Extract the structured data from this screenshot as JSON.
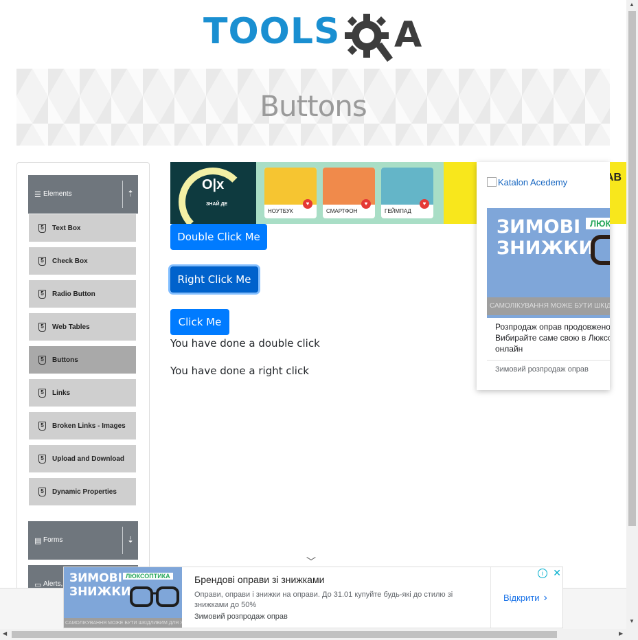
{
  "header": {
    "logo_text_tools": "TOOLS",
    "logo_text_qa": "A",
    "page_title": "Buttons"
  },
  "sidebar": {
    "groups": [
      {
        "label": "Elements",
        "icon": "hamburger-icon",
        "arrow": "upload-icon"
      },
      {
        "label": "Forms",
        "icon": "document-icon",
        "arrow": "download-icon"
      },
      {
        "label": "Alerts,",
        "icon": "window-icon"
      }
    ],
    "items": [
      {
        "label": "Text Box"
      },
      {
        "label": "Check Box"
      },
      {
        "label": "Radio Button"
      },
      {
        "label": "Web Tables"
      },
      {
        "label": "Buttons",
        "active": true
      },
      {
        "label": "Links"
      },
      {
        "label": "Broken Links - Images"
      },
      {
        "label": "Upload and Download"
      },
      {
        "label": "Dynamic Properties"
      }
    ]
  },
  "main": {
    "double_click_button": "Double Click Me",
    "right_click_button": "Right Click Me",
    "click_button": "Click Me",
    "double_click_message": "You have done a double click",
    "right_click_message": "You have done a right click"
  },
  "ad_top": {
    "brand": "O|x",
    "tagline": "ЗНАЙ ДЕ",
    "cards": [
      "НОУТБУК",
      "СМАРТФОН",
      "ГЕЙМПАД"
    ]
  },
  "ad_side": {
    "image_alt": "Katalon Acedemy",
    "banner_title": "ЗИМОВІ ЗНИЖКИ",
    "banner_brand": "ЛЮКС",
    "banner_warning": "САМОЛІКУВАННЯ МОЖЕ БУТИ ШКІДЛИВИМ ДЛ",
    "desc_line1": "Розпродаж оправ продовжено д",
    "desc_line2": "Вибирайте саме свою в Люксопт",
    "desc_line3": "онлайн",
    "footer": "Зимовий розпродаж оправ"
  },
  "ad_strip": {
    "text": "AB"
  },
  "ad_bottom": {
    "banner_title": "ЗИМОВІ ЗНИЖКИ",
    "banner_brand": "ЛЮКСОПТИКА",
    "banner_warning": "САМОЛІКУВАННЯ МОЖЕ БУТИ ШКІДЛИВИМ ДЛЯ ЗДОРОВ'Я",
    "title": "Брендові оправи зі знижками",
    "text": "Оправи, оправи і знижки на оправи. До 31.01 купуйте будь-які до стилю зі знижками до 50%",
    "source": "Зимовий розпродаж оправ",
    "cta": "Відкрити"
  },
  "colors": {
    "primary": "#007bff",
    "logo_blue": "#1a8fd1",
    "sidebar_header": "#6f767d",
    "sidebar_item": "#cfcfcf",
    "sidebar_item_active": "#a9a9a9"
  }
}
